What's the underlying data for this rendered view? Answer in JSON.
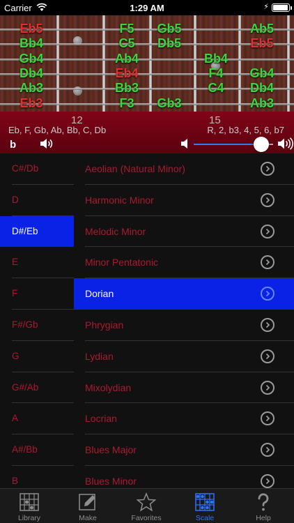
{
  "status": {
    "carrier": "Carrier",
    "time": "1:29 AM"
  },
  "fretboard": {
    "rows": [
      [
        "Eb5",
        "F5",
        "Gb5",
        "",
        "Ab5"
      ],
      [
        "Bb4",
        "C5",
        "Db5",
        "",
        "Eb5"
      ],
      [
        "Gb4",
        "Ab4",
        "",
        "Bb4",
        ""
      ],
      [
        "Db4",
        "Eb4",
        "",
        "F4",
        "Gb4"
      ],
      [
        "Ab3",
        "Bb3",
        "",
        "C4",
        "Db4"
      ],
      [
        "Eb3",
        "F3",
        "Gb3",
        "",
        "Ab3"
      ]
    ],
    "root_note_names": [
      "Eb3",
      "Eb4",
      "Eb5"
    ]
  },
  "info": {
    "fret_left": "12",
    "fret_right": "15",
    "scale_notes": "Eb, F, Gb, Ab, Bb, C, Db",
    "intervals": "R, 2, b3, 4, 5, 6, b7",
    "accidental": "b",
    "volume_fraction": 0.85
  },
  "keys": {
    "items": [
      "C#/Db",
      "D",
      "D#/Eb",
      "E",
      "F",
      "F#/Gb",
      "G",
      "G#/Ab",
      "A",
      "A#/Bb",
      "B"
    ],
    "selected": "D#/Eb"
  },
  "scales": {
    "items": [
      "Aeolian (Natural Minor)",
      "Harmonic Minor",
      "Melodic Minor",
      "Minor Pentatonic",
      "Dorian",
      "Phrygian",
      "Lydian",
      "Mixolydian",
      "Locrian",
      "Blues Major",
      "Blues Minor"
    ],
    "selected": "Dorian"
  },
  "tabs": [
    {
      "label": "Library",
      "icon": "library-icon"
    },
    {
      "label": "Make",
      "icon": "pencil-icon"
    },
    {
      "label": "Favorites",
      "icon": "star-icon"
    },
    {
      "label": "Scale",
      "icon": "scale-icon",
      "active": true
    },
    {
      "label": "Help",
      "icon": "question-icon"
    }
  ],
  "colors": {
    "accent_blue": "#0a22e6",
    "in_scale_note": "#39d83a",
    "root_note": "#e23030",
    "list_text": "#a91a30",
    "header_red": "#800416"
  }
}
